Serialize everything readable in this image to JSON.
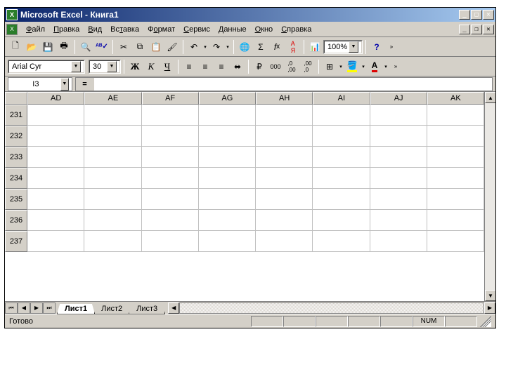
{
  "title": "Microsoft Excel - Книга1",
  "menu": [
    "Файл",
    "Правка",
    "Вид",
    "Вставка",
    "Формат",
    "Сервис",
    "Данные",
    "Окно",
    "Справка"
  ],
  "menu_accel": [
    0,
    0,
    0,
    2,
    1,
    0,
    0,
    0,
    0
  ],
  "toolbar1_icons": [
    "new-file-icon",
    "open-icon",
    "save-icon",
    "print-icon",
    "print-preview-icon",
    "spellcheck-icon",
    "cut-icon",
    "copy-icon",
    "paste-icon",
    "format-painter-icon",
    "undo-icon",
    "redo-icon",
    "hyperlink-icon",
    "autosum-icon",
    "function-icon",
    "sort-asc-icon",
    "chart-icon"
  ],
  "zoom": "100%",
  "font": "Arial Cyr",
  "font_size": "30",
  "namebox": "I3",
  "formula_prefix": "=",
  "columns": [
    "AD",
    "AE",
    "AF",
    "AG",
    "AH",
    "AI",
    "AJ",
    "AK"
  ],
  "rows": [
    "231",
    "232",
    "233",
    "234",
    "235",
    "236",
    "237"
  ],
  "sheets": [
    "Лист1",
    "Лист2",
    "Лист3"
  ],
  "active_sheet": 0,
  "status": "Готово",
  "numlock": "NUM"
}
